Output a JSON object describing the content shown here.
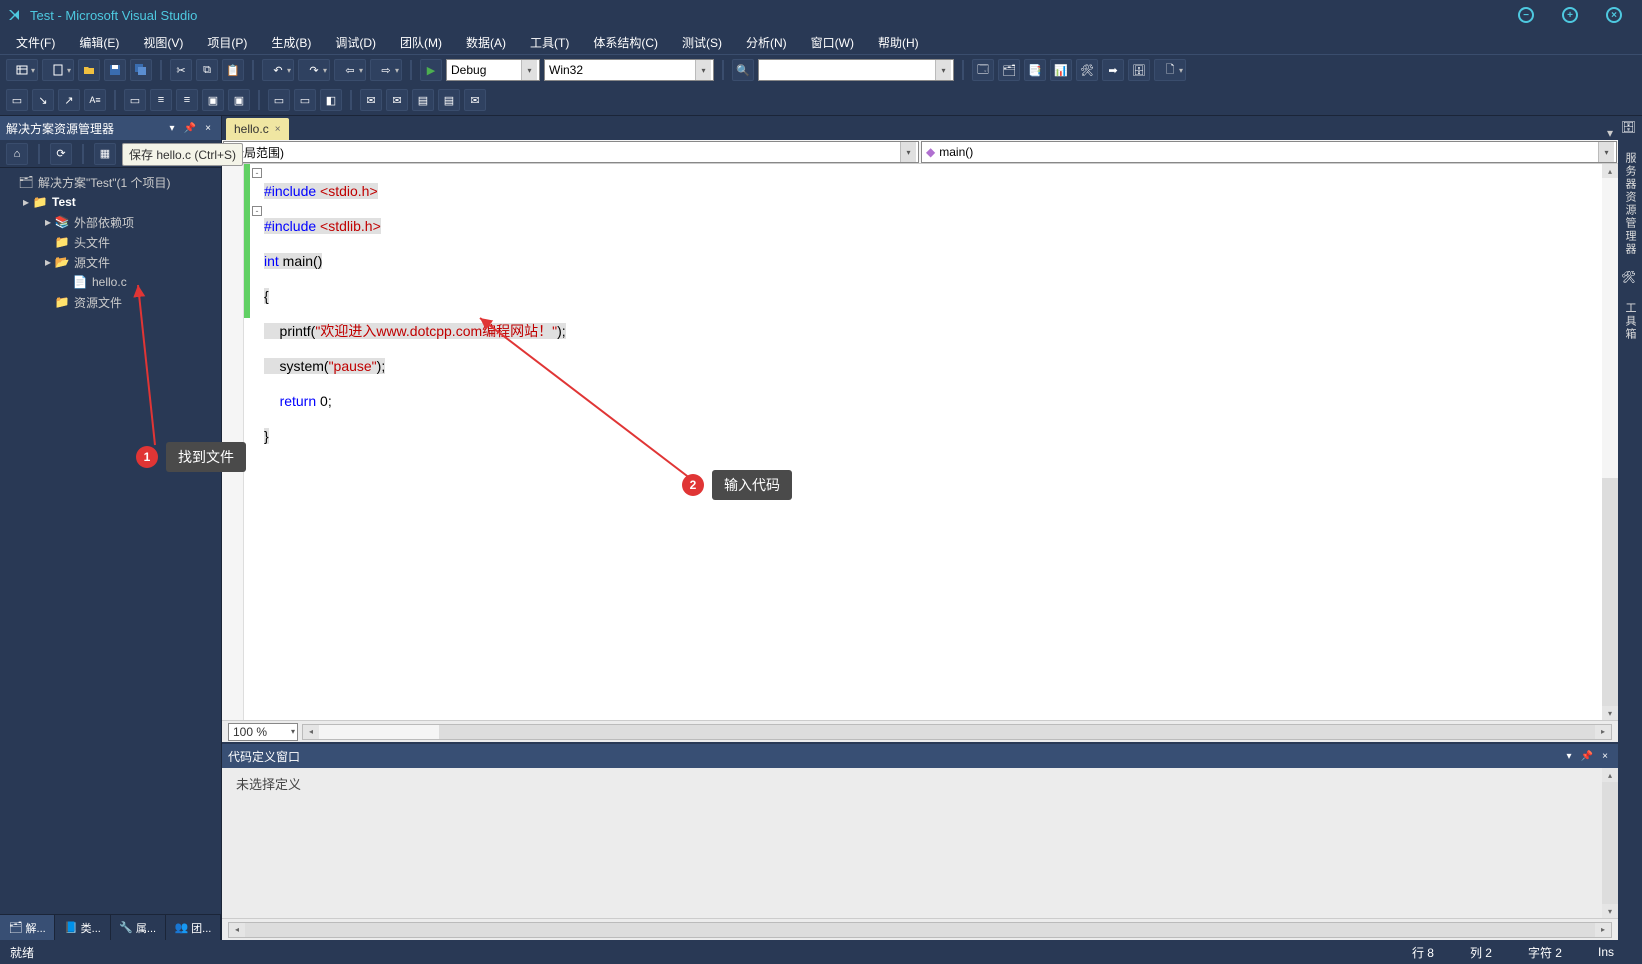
{
  "title": "Test - Microsoft Visual Studio",
  "menu": [
    "文件(F)",
    "编辑(E)",
    "视图(V)",
    "项目(P)",
    "生成(B)",
    "调试(D)",
    "团队(M)",
    "数据(A)",
    "工具(T)",
    "体系结构(C)",
    "测试(S)",
    "分析(N)",
    "窗口(W)",
    "帮助(H)"
  ],
  "tooltip": "保存 hello.c (Ctrl+S)",
  "combo_config": "Debug",
  "combo_platform": "Win32",
  "sidebar": {
    "title": "解决方案资源管理器",
    "solution": "解决方案\"Test\"(1 个项目)",
    "project": "Test",
    "ext_deps": "外部依赖项",
    "headers": "头文件",
    "sources": "源文件",
    "hello": "hello.c",
    "resources": "资源文件",
    "tabs": [
      "解...",
      "类...",
      "属...",
      "团..."
    ]
  },
  "editor": {
    "tab": "hello.c",
    "scope": "(全局范围)",
    "func": "main()",
    "zoom": "100 %"
  },
  "code": {
    "l1a": "#include ",
    "l1b": "<stdio.h>",
    "l2a": "#include ",
    "l2b": "<stdlib.h>",
    "l3a": "int",
    "l3b": " main()",
    "l4": "{",
    "l5a": "    printf(",
    "l5b": "\"欢迎进入www.dotcpp.com编程网站！\"",
    "l5c": ");",
    "l6a": "    system(",
    "l6b": "\"pause\"",
    "l6c": ");",
    "l7a": "    ",
    "l7b": "return",
    "l7c": " 0;",
    "l8": "}"
  },
  "bottom": {
    "title": "代码定义窗口",
    "text": "未选择定义"
  },
  "right": {
    "t1": "服务器资源管理器",
    "t2": "工具箱"
  },
  "status": {
    "ready": "就绪",
    "line": "行 8",
    "col": "列 2",
    "ch": "字符 2",
    "ins": "Ins"
  },
  "ann": {
    "a1": "1",
    "t1": "找到文件",
    "a2": "2",
    "t2": "输入代码"
  }
}
